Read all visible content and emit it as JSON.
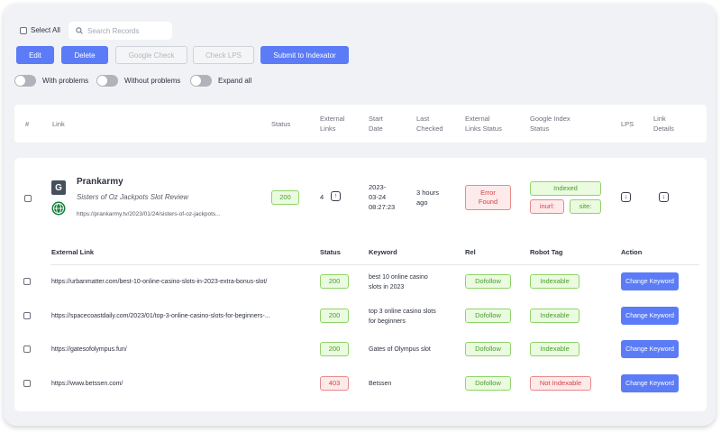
{
  "toolbar": {
    "select_all_label": "Select All",
    "search_placeholder": "Search Records",
    "buttons": {
      "edit": "Edit",
      "delete": "Delete",
      "google_check": "Google Check",
      "check_lps": "Check LPS",
      "submit": "Submit to Indexator"
    },
    "toggles": {
      "with_problems": "With problems",
      "without_problems": "Without problems",
      "expand_all": "Expand all"
    }
  },
  "table_header": {
    "hash": "#",
    "link": "Link",
    "status": "Status",
    "external_links": [
      "External",
      "Links"
    ],
    "start_date": [
      "Start",
      "Date"
    ],
    "last_checked": [
      "Last",
      "Checked"
    ],
    "external_links_status": [
      "External",
      "Links Status"
    ],
    "google_index_status": [
      "Google Index",
      "Status"
    ],
    "lps": "LPS",
    "link_details": [
      "Link",
      "Details"
    ]
  },
  "record": {
    "site_name": "Prankarmy",
    "page_title": "Sisters of Oz Jackpots Slot Review",
    "url": "https://prankarmy.tv/2023/01/24/sisters-of-oz-jackpots...",
    "status": "200",
    "external_links": "4",
    "start_date": [
      "2023-",
      "03-24",
      "08:27:23"
    ],
    "last_checked": [
      "3 hours",
      "ago"
    ],
    "external_links_status": [
      "Error",
      "Found"
    ],
    "google_index": {
      "indexed": "Indexed",
      "inurl": "inurl:",
      "site": "site:"
    },
    "logo_letter": "G"
  },
  "sub_table": {
    "headers": {
      "external_link": "External Link",
      "status": "Status",
      "keyword": "Keyword",
      "rel": "Rel",
      "robot_tag": "Robot Tag",
      "action": "Action"
    },
    "rows": [
      {
        "link": "https://urbanmatter.com/best-10-online-casino-slots-in-2023-extra-bonus-slot/",
        "status": "200",
        "keyword": [
          "best 10 online casino",
          "slots in 2023"
        ],
        "rel": "Dofollow",
        "robot_tag": "Indexable",
        "action": "Change Keyword"
      },
      {
        "link": "https://spacecoastdaily.com/2023/01/top-3-online-casino-slots-for-beginners-...",
        "status": "200",
        "keyword": [
          "top 3 online casino slots",
          "for beginners"
        ],
        "rel": "Dofollow",
        "robot_tag": "Indexable",
        "action": "Change Keyword"
      },
      {
        "link": "https://gatesofolympus.fun/",
        "status": "200",
        "keyword": [
          "Gates of Olympus slot"
        ],
        "rel": "Dofollow",
        "robot_tag": "Indexable",
        "action": "Change Keyword"
      },
      {
        "link": "https://www.betssen.com/",
        "status": "403",
        "keyword": [
          "Betssen"
        ],
        "rel": "Dofollow",
        "robot_tag": "Not Indexable",
        "action": "Change Keyword"
      }
    ]
  },
  "colors": {
    "primary": "#5b7cf6",
    "success": "#4c9b2e",
    "danger": "#d34343",
    "background": "#f1f2f5"
  }
}
